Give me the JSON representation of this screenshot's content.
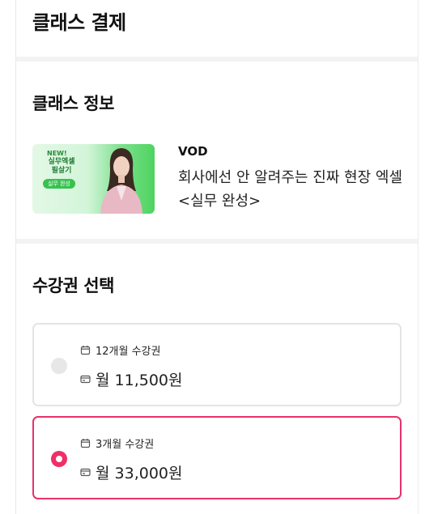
{
  "header": {
    "title": "클래스 결제"
  },
  "class_info": {
    "section_title": "클래스 정보",
    "thumbnail": {
      "badge": "NEW!",
      "title": "실무엑셀 필살기",
      "tag": "실무 완성"
    },
    "type": "VOD",
    "name": "회사에선 안 알려주는 진짜 현장 엑셀 <실무 완성>"
  },
  "pass_select": {
    "section_title": "수강권 선택",
    "options": [
      {
        "period": "12개월 수강권",
        "price": "월 11,500원",
        "selected": false
      },
      {
        "period": "3개월 수강권",
        "price": "월 33,000원",
        "selected": true
      }
    ]
  },
  "colors": {
    "accent": "#ef2f66",
    "accent_border": "#e8326b",
    "divider": "#f3f3f3",
    "thumb_green": "#4dd45f"
  }
}
